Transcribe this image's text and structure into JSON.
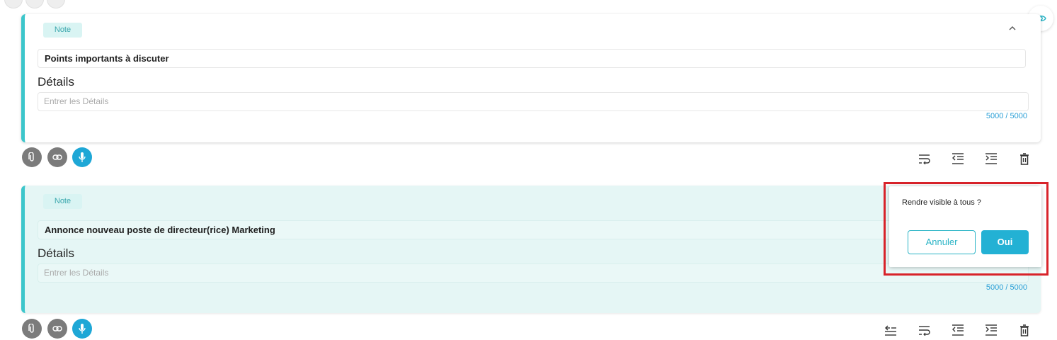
{
  "notes": [
    {
      "tag": "Note",
      "title": "Points importants à discuter",
      "details_label": "Détails",
      "details_placeholder": "Entrer les Détails",
      "counter": "5000 / 5000"
    },
    {
      "tag": "Note",
      "title": "Annonce nouveau poste de directeur(rice) Marketing",
      "details_label": "Détails",
      "details_placeholder": "Entrer les Détails",
      "counter": "5000 / 5000"
    }
  ],
  "popup": {
    "question": "Rendre visible à tous ?",
    "cancel_label": "Annuler",
    "confirm_label": "Oui"
  },
  "colors": {
    "accent": "#3cc6cb",
    "highlight_bg": "#e5f6f5",
    "counter": "#2a9fd6",
    "mic_button": "#1ea7d6",
    "alert_frame": "#d8232a"
  },
  "icons": {
    "attachment": "paperclip-icon",
    "link": "link-icon",
    "microphone": "microphone-icon",
    "wrap": "wrap-text-icon",
    "outdent": "outdent-icon",
    "indent": "indent-icon",
    "delete": "trash-icon",
    "visibility": "eye-icon",
    "collapse": "chevron-up-icon",
    "align": "align-icon"
  }
}
